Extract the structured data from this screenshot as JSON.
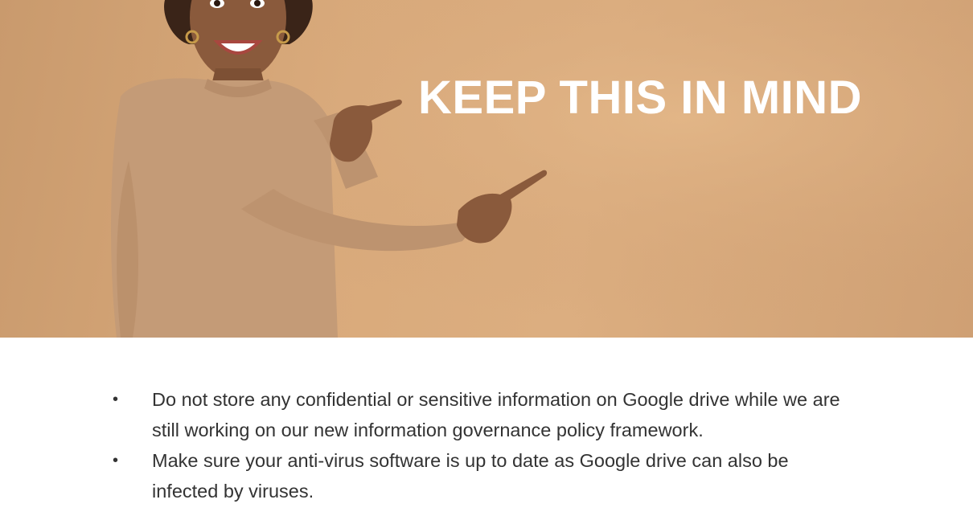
{
  "hero": {
    "title": "KEEP THIS IN MIND",
    "background_color": "#d9aa7b",
    "title_color": "#ffffff"
  },
  "content": {
    "bullet_symbol": "•",
    "bullets": [
      " Do not store any confidential or sensitive information on Google drive while we are still working on our new information governance policy framework.",
      "Make sure your anti-virus software is up to date as Google drive can also be infected by viruses."
    ]
  }
}
